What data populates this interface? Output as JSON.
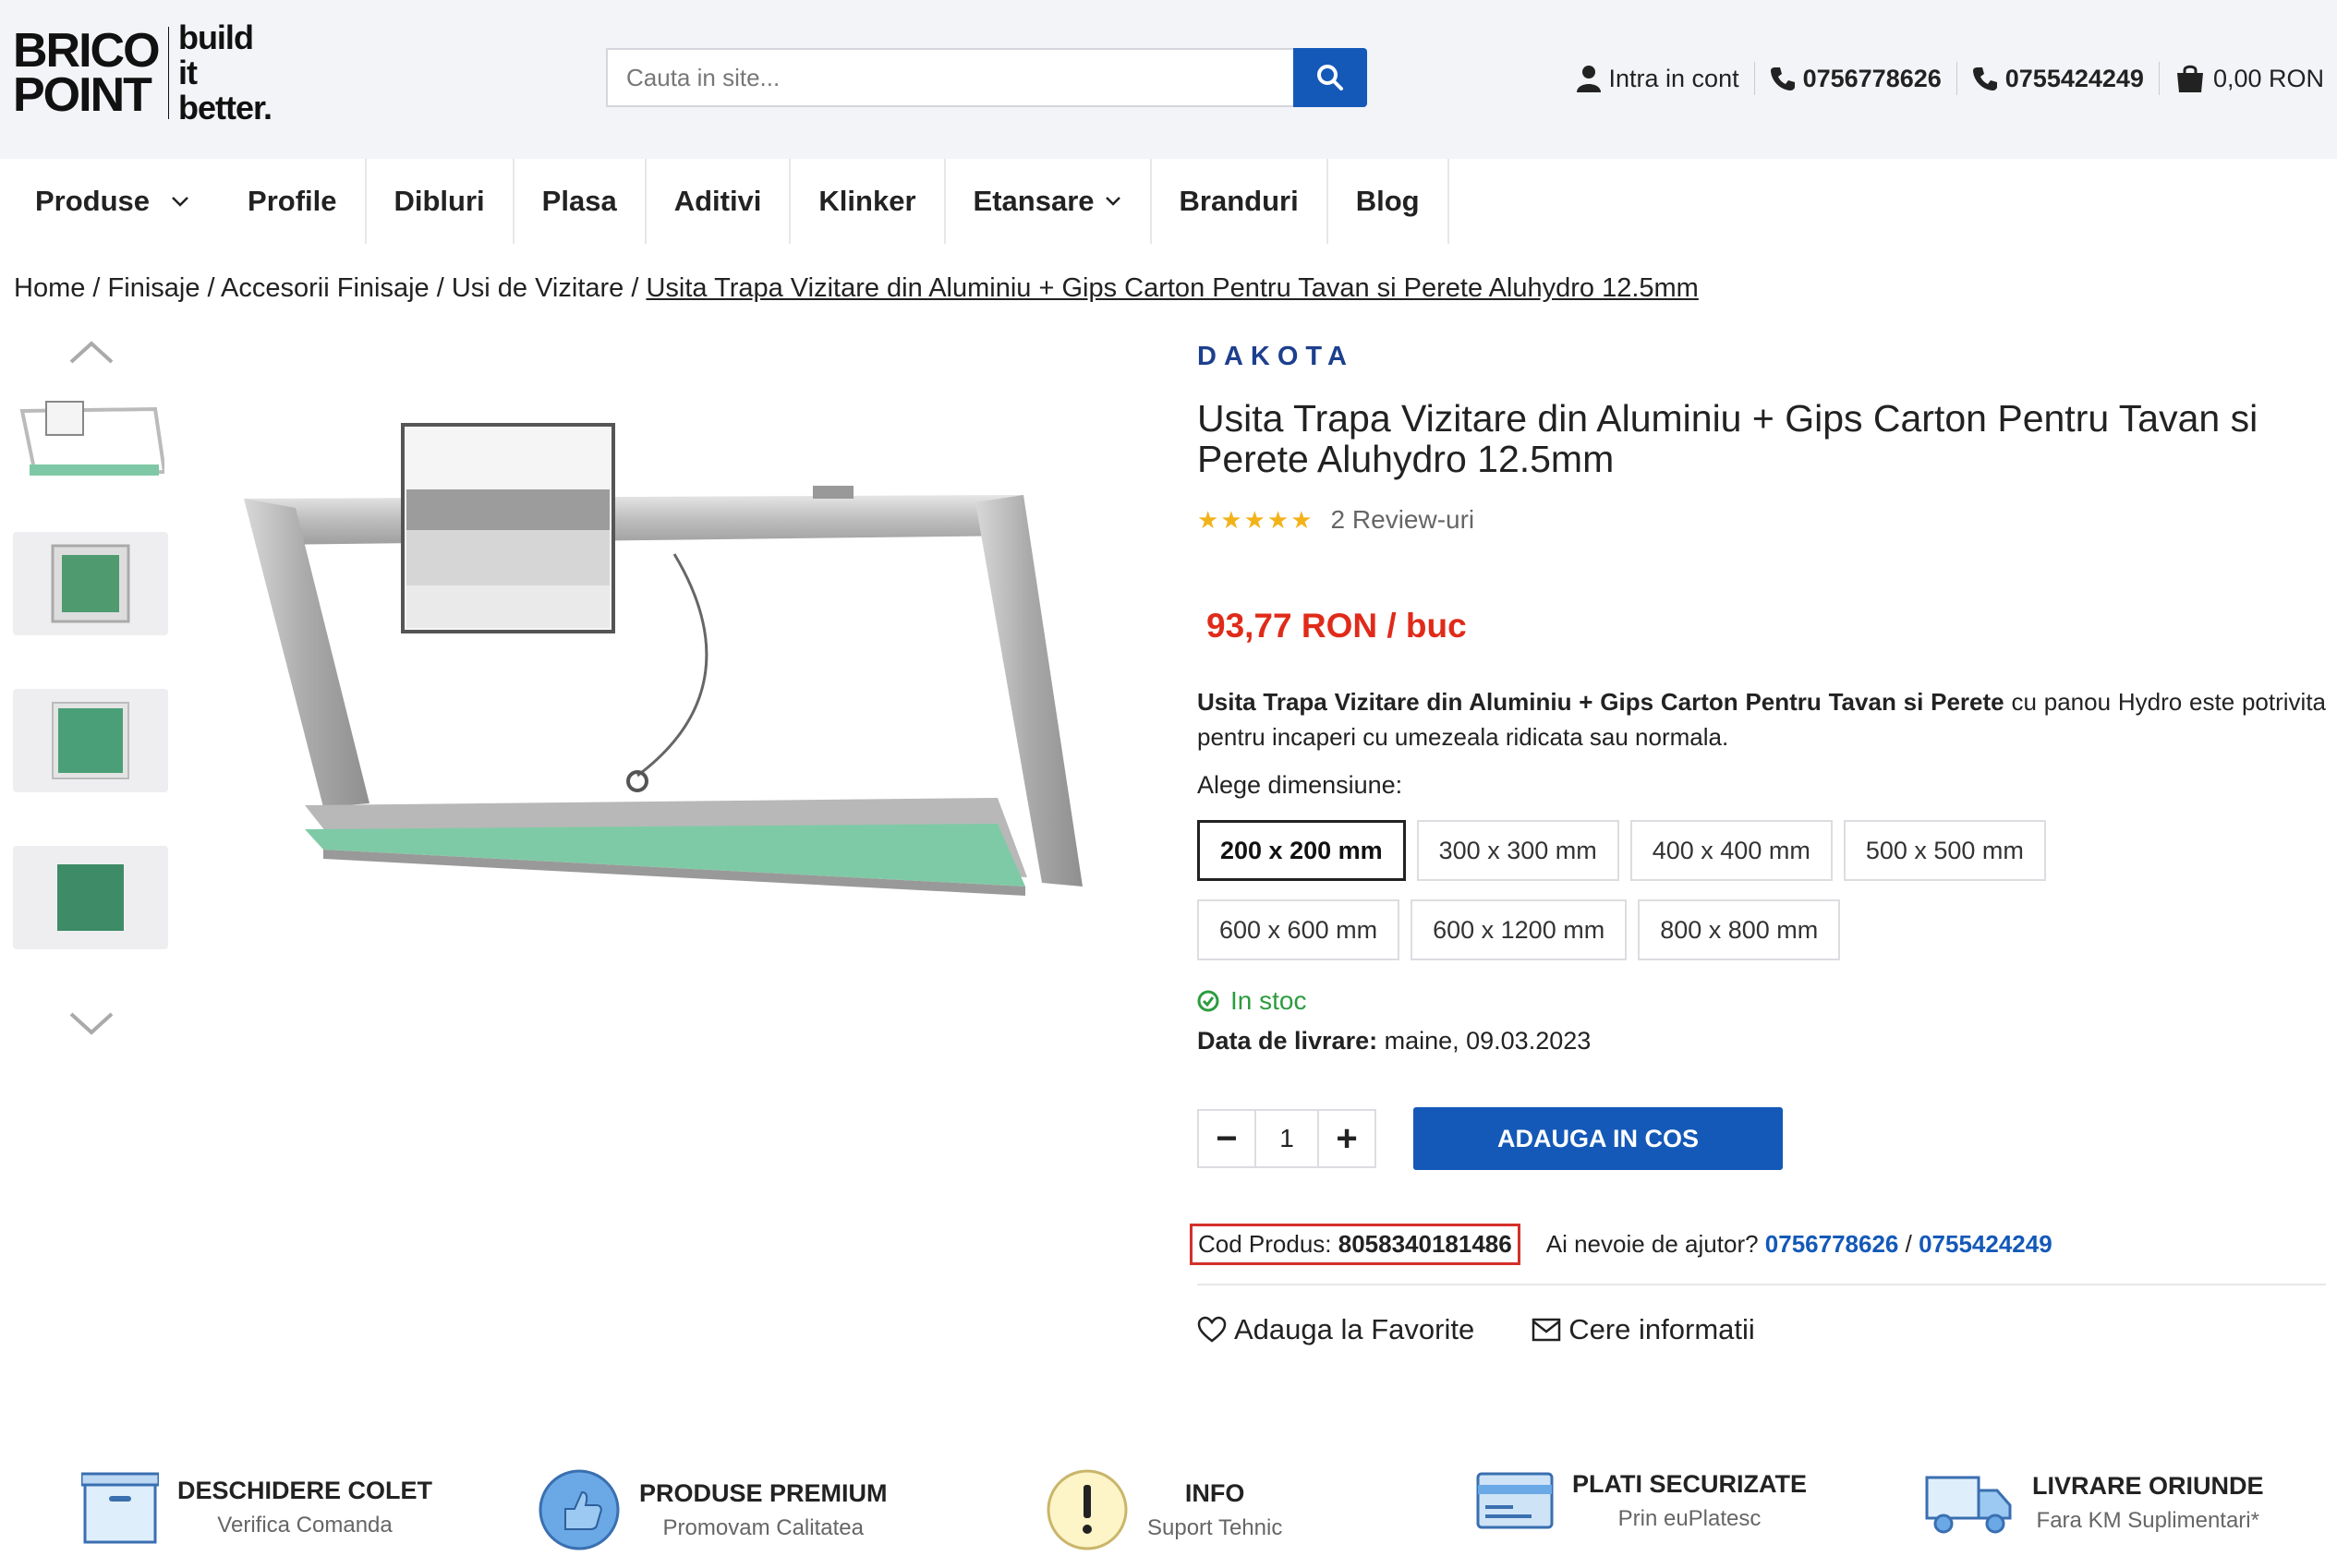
{
  "header": {
    "logo_left_1": "BRICO",
    "logo_left_2": "POINT",
    "logo_right_1": "build it",
    "logo_right_2": "better.",
    "search_placeholder": "Cauta in site...",
    "account": "Intra in cont",
    "phone1": "0756778626",
    "phone2": "0755424249",
    "cart": "0,00 RON"
  },
  "nav": {
    "items": [
      "Produse",
      "Profile",
      "Dibluri",
      "Plasa",
      "Aditivi",
      "Klinker",
      "Etansare",
      "Branduri",
      "Blog"
    ]
  },
  "breadcrumb": {
    "home": "Home",
    "sep": " / ",
    "c1": "Finisaje",
    "c2": "Accesorii Finisaje",
    "c3": "Usi de Vizitare",
    "current": "Usita Trapa Vizitare din Aluminiu + Gips Carton Pentru Tavan si Perete Aluhydro 12.5mm"
  },
  "product": {
    "brand": "DAKOTA",
    "title": "Usita Trapa Vizitare din Aluminiu + Gips Carton Pentru Tavan si Perete Aluhydro 12.5mm",
    "stars": "★★★★★",
    "reviews": "2 Review-uri",
    "price": "93,77 RON / buc",
    "desc_bold": "Usita Trapa Vizitare din Aluminiu + Gips Carton Pentru Tavan si Perete",
    "desc_rest": " cu panou Hydro este potrivita pentru incaperi cu umezeala ridicata sau normala.",
    "size_label": "Alege dimensiune:",
    "sizes": [
      "200 x 200 mm",
      "300 x 300 mm",
      "400 x 400 mm",
      "500 x 500 mm",
      "600 x 600 mm",
      "600 x 1200 mm",
      "800 x 800 mm"
    ],
    "stock": "In stoc",
    "delivery_label": "Data de livrare:",
    "delivery_value": " maine, 09.03.2023",
    "qty": "1",
    "qty_minus": "−",
    "qty_plus": "+",
    "add_to_cart": "ADAUGA IN COS",
    "code_label": "Cod Produs: ",
    "code_value": "8058340181486",
    "help_text": "Ai nevoie de ajutor? ",
    "help_phone1": "0756778626",
    "help_sep": " / ",
    "help_phone2": "0755424249",
    "favorite": "Adauga la Favorite",
    "info_request": "Cere informatii"
  },
  "features": [
    {
      "title": "DESCHIDERE COLET",
      "subtitle": "Verifica Comanda"
    },
    {
      "title": "PRODUSE PREMIUM",
      "subtitle": "Promovam Calitatea"
    },
    {
      "title": "INFO",
      "subtitle": "Suport Tehnic"
    },
    {
      "title": "PLATI SECURIZATE",
      "subtitle": "Prin euPlatesc"
    },
    {
      "title": "LIVRARE ORIUNDE",
      "subtitle": "Fara KM Suplimentari*"
    }
  ],
  "colors": {
    "accent_blue": "#1459b8",
    "price_red": "#e02b1a",
    "stock_green": "#2c9c3e",
    "star_gold": "#f2b31a",
    "header_bg": "#f3f4f8"
  }
}
